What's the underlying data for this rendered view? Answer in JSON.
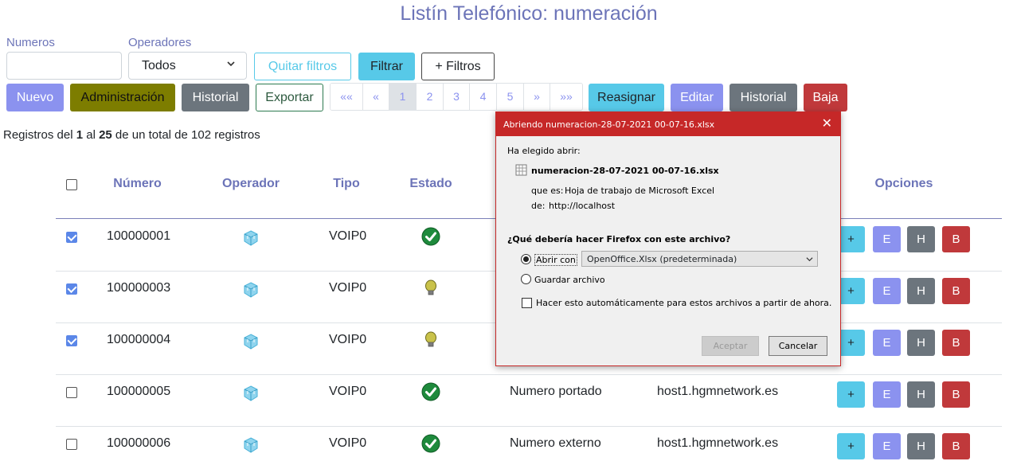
{
  "page": {
    "title": "Listín Telefónico: numeración"
  },
  "filters": {
    "numeros_label": "Numeros",
    "numeros_value": "",
    "operadores_label": "Operadores",
    "operadores_value": "Todos",
    "quitar_label": "Quitar filtros",
    "filtrar_label": "Filtrar",
    "mas_filtros_label": "+ Filtros"
  },
  "toolbar": {
    "nuevo": "Nuevo",
    "administracion": "Administración",
    "historial": "Historial",
    "exportar": "Exportar",
    "reasignar": "Reasignar",
    "editar": "Editar",
    "historial2": "Historial",
    "baja": "Baja"
  },
  "pagination": {
    "items": [
      "««",
      "«",
      "1",
      "2",
      "3",
      "4",
      "5",
      "»",
      "»»"
    ],
    "active": "1"
  },
  "records": {
    "prefix": "Registros del ",
    "from": "1",
    "mid1": " al ",
    "to": "25",
    "suffix": " de un total de 102 registros"
  },
  "table": {
    "headers": {
      "numero": "Número",
      "operador": "Operador",
      "tipo": "Tipo",
      "estado": "Estado",
      "opciones": "Opciones"
    },
    "rows": [
      {
        "checked": true,
        "numero": "100000001",
        "tipo": "VOIP0",
        "estado": "ok",
        "descripcion": "",
        "host": ""
      },
      {
        "checked": true,
        "numero": "100000003",
        "tipo": "VOIP0",
        "estado": "pending",
        "descripcion": "",
        "host": ""
      },
      {
        "checked": true,
        "numero": "100000004",
        "tipo": "VOIP0",
        "estado": "pending",
        "descripcion": "",
        "host": ""
      },
      {
        "checked": false,
        "numero": "100000005",
        "tipo": "VOIP0",
        "estado": "ok",
        "descripcion": "Numero portado",
        "host": "host1.hgmnetwork.es"
      },
      {
        "checked": false,
        "numero": "100000006",
        "tipo": "VOIP0",
        "estado": "ok",
        "descripcion": "Numero externo",
        "host": "host1.hgmnetwork.es"
      }
    ],
    "option_labels": {
      "plus": "+",
      "e": "E",
      "h": "H",
      "b": "B"
    }
  },
  "dialog": {
    "title": "Abriendo numeracion-28-07-2021 00-07-16.xlsx",
    "close": "✕",
    "chosen_label": "Ha elegido abrir:",
    "filename": "numeracion-28-07-2021 00-07-16.xlsx",
    "type_label": "que es:",
    "type_value": "Hoja de trabajo de Microsoft Excel",
    "from_label": "de:",
    "from_value": "http://localhost",
    "question": "¿Qué debería hacer Firefox con este archivo?",
    "open_with_label": "Abrir con",
    "open_with_value": "OpenOffice.Xlsx (predeterminada)",
    "save_label": "Guardar archivo",
    "auto_label": "Hacer esto automáticamente para estos archivos a partir de ahora.",
    "accept": "Aceptar",
    "cancel": "Cancelar"
  },
  "colors": {
    "accent": "#8b92ef",
    "info": "#57c9e8",
    "danger": "#c0393b",
    "dialog_border": "#c62828"
  }
}
